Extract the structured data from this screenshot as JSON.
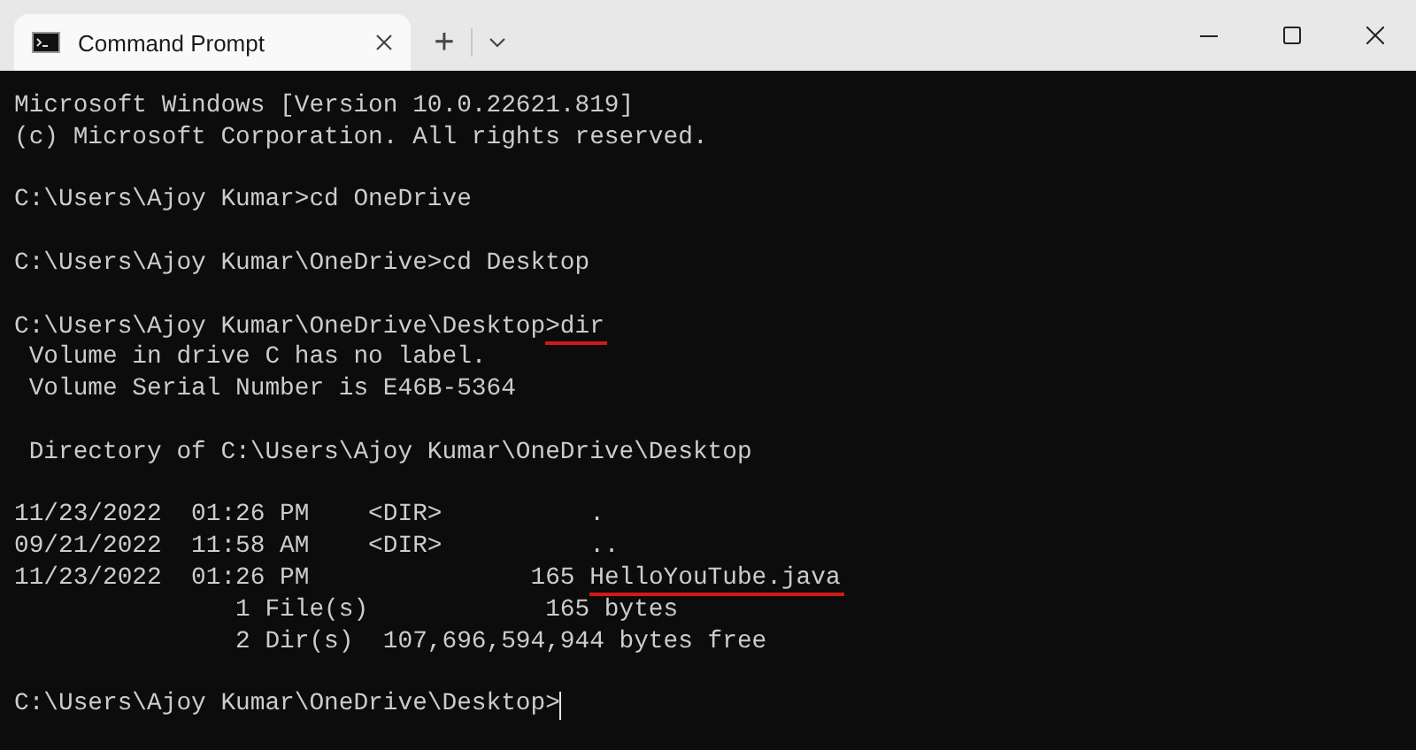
{
  "window": {
    "tab": {
      "title": "Command Prompt",
      "selected": true
    },
    "new_tab_button": "+"
  },
  "terminal": {
    "blocks": [
      [
        {
          "segments": [
            {
              "text": "Microsoft Windows [Version 10.0.22621.819]",
              "underlined": false
            }
          ]
        },
        {
          "segments": [
            {
              "text": "(c) Microsoft Corporation. All rights reserved.",
              "underlined": false
            }
          ]
        }
      ],
      [
        {
          "segments": [
            {
              "text": "C:\\Users\\Ajoy Kumar>cd OneDrive",
              "underlined": false
            }
          ]
        }
      ],
      [
        {
          "segments": [
            {
              "text": "C:\\Users\\Ajoy Kumar\\OneDrive>cd Desktop",
              "underlined": false
            }
          ]
        }
      ],
      [
        {
          "segments": [
            {
              "text": "C:\\Users\\Ajoy Kumar\\OneDrive\\Desktop",
              "underlined": false
            },
            {
              "text": ">dir",
              "underlined": true
            }
          ]
        },
        {
          "segments": [
            {
              "text": " Volume in drive C has no label.",
              "underlined": false
            }
          ]
        },
        {
          "segments": [
            {
              "text": " Volume Serial Number is E46B-5364",
              "underlined": false
            }
          ]
        }
      ],
      [
        {
          "segments": [
            {
              "text": " Directory of C:\\Users\\Ajoy Kumar\\OneDrive\\Desktop",
              "underlined": false
            }
          ]
        }
      ],
      [
        {
          "segments": [
            {
              "text": "11/23/2022  01:26 PM    <DIR>          .",
              "underlined": false
            }
          ]
        },
        {
          "segments": [
            {
              "text": "09/21/2022  11:58 AM    <DIR>          ..",
              "underlined": false
            }
          ]
        },
        {
          "segments": [
            {
              "text": "11/23/2022  01:26 PM               165 ",
              "underlined": false
            },
            {
              "text": "HelloYouTube.java",
              "underlined": true
            }
          ]
        },
        {
          "segments": [
            {
              "text": "               1 File(s)            165 bytes",
              "underlined": false
            }
          ]
        },
        {
          "segments": [
            {
              "text": "               2 Dir(s)  107,696,594,944 bytes free",
              "underlined": false
            }
          ]
        }
      ],
      [
        {
          "segments": [
            {
              "text": "C:\\Users\\Ajoy Kumar\\OneDrive\\Desktop>",
              "underlined": false
            }
          ],
          "cursor": true
        }
      ]
    ]
  }
}
